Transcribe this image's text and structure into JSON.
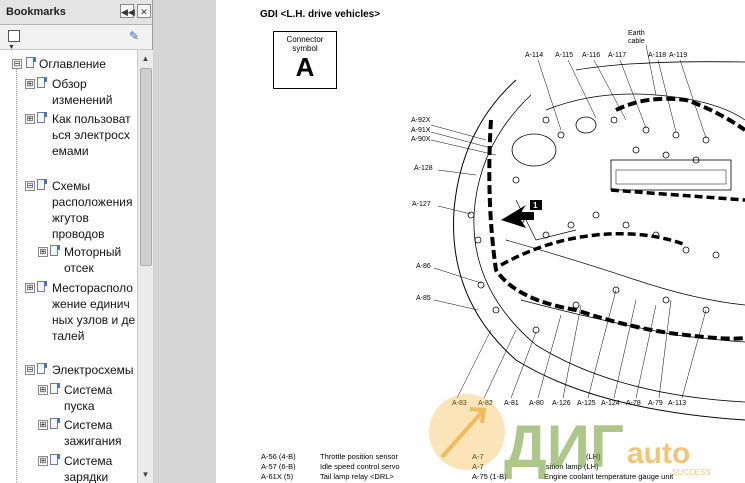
{
  "bookmarks": {
    "title": "Bookmarks",
    "collapse_icon": "double-chevron-left",
    "close_icon": "close-x",
    "options_icon": "bookmark-options",
    "tool_icon": "bookmark-tool",
    "items": [
      {
        "label": "Оглавление",
        "toggle": "⊟"
      },
      {
        "label": "Обзор изменений",
        "toggle": "⊞"
      },
      {
        "label": "Как пользоваться электросхемами",
        "toggle": "⊞"
      },
      {
        "label": "Схемы расположения жгутов проводов",
        "toggle": "⊟"
      },
      {
        "label": "Моторный отсек",
        "toggle": "⊞"
      },
      {
        "label": "Месторасположение единичных узлов и деталей",
        "toggle": "⊞"
      },
      {
        "label": "Электросхемы",
        "toggle": "⊟"
      },
      {
        "label": "Система пуска",
        "toggle": "⊞"
      },
      {
        "label": "Система зажигания",
        "toggle": "⊞"
      },
      {
        "label": "Система зарядки",
        "toggle": "⊞"
      }
    ]
  },
  "document": {
    "heading": "GDI <L.H. drive vehicles>",
    "connector_label": "Connector\nsymbol",
    "connector_letter": "A",
    "earth_label": "Earth\ncable",
    "marker": "1",
    "top_labels": [
      "A-114",
      "A-115",
      "A-116",
      "A-117",
      "A-118",
      "A-119"
    ],
    "left_labels": [
      "A-92X",
      "A-91X",
      "A-90X",
      "A-128",
      "A-127",
      "A-86",
      "A-85"
    ],
    "bottom_labels": [
      "A-83",
      "A-82",
      "A-81",
      "A-80",
      "A-126",
      "A-125",
      "A-124",
      "A-78",
      "A-79",
      "A-113"
    ],
    "legend_left": [
      {
        "code": "A-56 (4-B)",
        "desc": "Throttle position sensor"
      },
      {
        "code": "A-57 (6-B)",
        "desc": "Idle speed control servo"
      },
      {
        "code": "A-61X (5)",
        "desc": "Tail lamp relay <DRL>"
      }
    ],
    "legend_right": [
      {
        "code": "A-7",
        "desc": "(LH)"
      },
      {
        "code": "A-7",
        "desc": "sition lamp (LH)"
      },
      {
        "code": "A-75 (1-B)",
        "desc": "Engine coolant temperature gauge unit"
      }
    ]
  },
  "watermark": {
    "text1": "ДИГ",
    "text2": "auto",
    "tagline": "SUCCESS"
  }
}
